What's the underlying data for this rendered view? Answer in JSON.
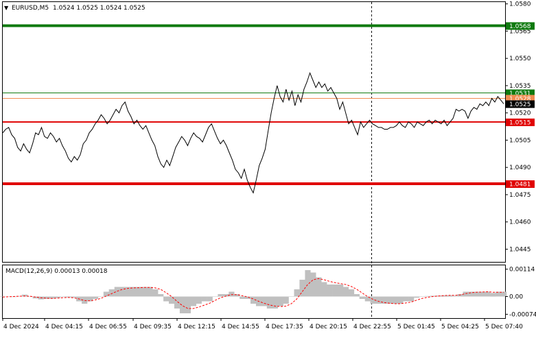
{
  "header": {
    "symbol": "EURUSD,M5",
    "ohlc": "1.0524 1.0525 1.0524 1.0525"
  },
  "macd": {
    "label": "MACD(12,26,9) 0.00013 0.00018",
    "tick_labels": [
      "0.00114",
      "0.00",
      "-0.00074"
    ]
  },
  "chart_data": [
    {
      "type": "line",
      "title": "EURUSD,M5 1.0524 1.0525 1.0524 1.0525",
      "x_tick_labels": [
        "4 Dec 2024",
        "4 Dec 04:15",
        "4 Dec 06:55",
        "4 Dec 09:35",
        "4 Dec 12:15",
        "4 Dec 14:55",
        "4 Dec 17:35",
        "4 Dec 20:15",
        "4 Dec 22:55",
        "5 Dec 01:45",
        "5 Dec 04:25",
        "5 Dec 07:40"
      ],
      "y_ticks": [
        1.058,
        1.0565,
        1.055,
        1.0535,
        1.052,
        1.0505,
        1.049,
        1.0475,
        1.046,
        1.0445
      ],
      "y_tick_labels": [
        "1.0580",
        "1.0565",
        "1.0550",
        "1.0535",
        "1.0520",
        "1.0505",
        "1.0490",
        "1.0475",
        "1.0460",
        "1.0445"
      ],
      "ylim": [
        1.0438,
        1.0581
      ],
      "grid": false,
      "levels": [
        {
          "value": 1.0568,
          "label": "1.0568",
          "color": "#0f7a0f",
          "style": "thick"
        },
        {
          "value": 1.0531,
          "label": "1.0531",
          "color": "#0f7a0f",
          "style": "thin"
        },
        {
          "value": 1.0528,
          "label": "1.0528",
          "color": "#f08c50",
          "style": "thin"
        },
        {
          "value": 1.0515,
          "label": "1.0515",
          "color": "#e00000",
          "style": "medium"
        },
        {
          "value": 1.0481,
          "label": "1.0481",
          "color": "#e00000",
          "style": "thick"
        }
      ],
      "current_price": {
        "value": 1.0525,
        "label": "1.0525"
      },
      "vertical_marker_x_index": 128,
      "series": [
        {
          "color": "#000000",
          "values": [
            1.0509,
            1.0511,
            1.0512,
            1.0508,
            1.0506,
            1.0501,
            1.0499,
            1.0503,
            1.05,
            1.0498,
            1.0503,
            1.0509,
            1.0508,
            1.0512,
            1.0507,
            1.0506,
            1.0509,
            1.0507,
            1.0504,
            1.0506,
            1.0502,
            1.0499,
            1.0495,
            1.0493,
            1.0496,
            1.0494,
            1.0497,
            1.0503,
            1.0505,
            1.0509,
            1.0511,
            1.0514,
            1.0516,
            1.0519,
            1.0517,
            1.0514,
            1.0516,
            1.0519,
            1.0522,
            1.052,
            1.0524,
            1.0526,
            1.0521,
            1.0518,
            1.0514,
            1.0516,
            1.0513,
            1.0511,
            1.0513,
            1.0509,
            1.0505,
            1.0502,
            1.0496,
            1.0492,
            1.049,
            1.0494,
            1.0491,
            1.0496,
            1.0501,
            1.0504,
            1.0507,
            1.0505,
            1.0502,
            1.0506,
            1.0509,
            1.0507,
            1.0506,
            1.0504,
            1.0508,
            1.0512,
            1.0514,
            1.051,
            1.0506,
            1.0503,
            1.0505,
            1.0502,
            1.0498,
            1.0494,
            1.0489,
            1.0487,
            1.0484,
            1.0489,
            1.0483,
            1.0479,
            1.0476,
            1.0483,
            1.0491,
            1.0495,
            1.05,
            1.051,
            1.052,
            1.0528,
            1.0535,
            1.0529,
            1.0526,
            1.0533,
            1.0527,
            1.0532,
            1.0524,
            1.053,
            1.0526,
            1.0533,
            1.0537,
            1.0542,
            1.0538,
            1.0534,
            1.0537,
            1.0534,
            1.0536,
            1.0532,
            1.0534,
            1.0531,
            1.0528,
            1.0522,
            1.0526,
            1.052,
            1.0514,
            1.0516,
            1.0512,
            1.0508,
            1.0515,
            1.0512,
            1.0514,
            1.0516,
            1.0514,
            1.0513,
            1.0512,
            1.0512,
            1.0511,
            1.0511,
            1.0512,
            1.0512,
            1.0513,
            1.0515,
            1.0513,
            1.0512,
            1.0515,
            1.0514,
            1.0512,
            1.0515,
            1.0514,
            1.0513,
            1.0515,
            1.0516,
            1.0514,
            1.0516,
            1.0515,
            1.0514,
            1.0516,
            1.0513,
            1.0515,
            1.0517,
            1.0522,
            1.0521,
            1.0522,
            1.0521,
            1.0517,
            1.0521,
            1.0523,
            1.0522,
            1.0525,
            1.0524,
            1.0526,
            1.0524,
            1.0528,
            1.0526,
            1.0529,
            1.0527,
            1.0525
          ]
        }
      ]
    },
    {
      "type": "bar",
      "title": "MACD(12,26,9) 0.00013 0.00018",
      "ylim": [
        -0.0009,
        0.0013
      ],
      "y_ticks": [
        0.00114,
        0.0,
        -0.00074
      ],
      "y_tick_labels": [
        "0.00114",
        "0.00",
        "-0.00074"
      ],
      "series": [
        {
          "name": "MACD",
          "color": "#c0c0c0",
          "values": [
            0.0,
            0.0,
            -2e-05,
            2e-05,
            8e-05,
            0.0,
            -8e-05,
            -0.00012,
            -0.0001,
            -9e-05,
            -6e-05,
            -2e-05,
            -3e-05,
            -4e-05,
            -0.0002,
            -0.0003,
            -0.0002,
            -0.0001,
            0.0,
            0.0002,
            0.0003,
            0.0004,
            0.0004,
            0.0004,
            0.0004,
            0.0004,
            0.0004,
            0.0004,
            0.0003,
            0.0001,
            -0.0002,
            -0.0003,
            -0.0005,
            -0.0007,
            -0.0007,
            -0.0004,
            -0.0003,
            -0.0002,
            -0.0002,
            0.0,
            0.0001,
            0.0001,
            0.0002,
            0.0001,
            -0.0001,
            -0.0001,
            -0.0003,
            -0.0004,
            -0.0004,
            -0.0005,
            -0.0005,
            -0.0004,
            -0.0003,
            0.0,
            0.0003,
            0.0007,
            0.0011,
            0.001,
            0.0008,
            0.0006,
            0.0005,
            0.0005,
            0.0005,
            0.0004,
            0.0003,
            0.0001,
            -0.0001,
            -0.0002,
            -0.0003,
            -0.0003,
            -0.0003,
            -0.0003,
            -0.0003,
            -0.0003,
            -0.0002,
            -0.0002,
            -5e-05,
            0.0,
            2e-05,
            3e-05,
            4e-05,
            5e-05,
            5e-05,
            3e-05,
            0.0001,
            0.0002,
            0.0002,
            0.0002,
            0.0002,
            0.0002,
            0.00015,
            0.0002,
            0.0002
          ]
        },
        {
          "name": "Signal",
          "color": "#ff0000",
          "values": [
            -2e-05,
            -1e-05,
            0.0,
            1e-05,
            2e-05,
            1e-05,
            -2e-05,
            -5e-05,
            -7e-05,
            -8e-05,
            -7e-05,
            -5e-05,
            -4e-05,
            -5e-05,
            -0.0001,
            -0.00017,
            -0.00018,
            -0.00014,
            -8e-05,
            2e-05,
            0.00012,
            0.00022,
            0.0003,
            0.00034,
            0.00036,
            0.00037,
            0.00038,
            0.00038,
            0.00036,
            0.0003,
            0.00016,
            0.0,
            -0.0002,
            -0.00038,
            -0.0005,
            -0.0005,
            -0.00044,
            -0.00036,
            -0.00028,
            -0.00016,
            -5e-05,
            2e-05,
            8e-05,
            8e-05,
            3e-05,
            -2e-05,
            -0.0001,
            -0.0002,
            -0.00028,
            -0.00035,
            -0.0004,
            -0.00042,
            -0.0004,
            -0.0003,
            -0.0001,
            0.0002,
            0.0005,
            0.0007,
            0.00075,
            0.0007,
            0.00063,
            0.00058,
            0.00054,
            0.0005,
            0.00042,
            0.0003,
            0.00015,
            0.0,
            -0.00012,
            -0.0002,
            -0.00025,
            -0.00028,
            -0.0003,
            -0.0003,
            -0.00027,
            -0.00023,
            -0.00015,
            -8e-05,
            -3e-05,
            0.0,
            2e-05,
            4e-05,
            5e-05,
            5e-05,
            7e-05,
            0.00012,
            0.00016,
            0.00018,
            0.00019,
            0.0002,
            0.00018,
            0.00018,
            0.00018
          ]
        }
      ]
    }
  ]
}
